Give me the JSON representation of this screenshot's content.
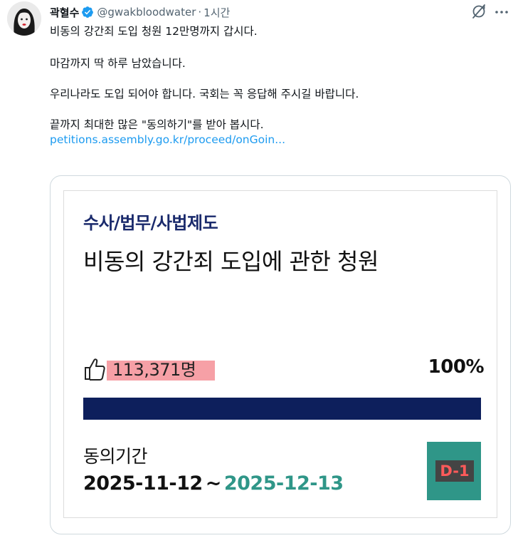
{
  "tweet": {
    "author_name": "곽혈수",
    "author_handle": "@gwakbloodwater",
    "separator": "·",
    "time": "1시간",
    "lines": [
      "비동의 강간죄 도입 청원 12만명까지 갑시다.",
      "마감까지 딱 하루 남았습니다.",
      "우리나라도 도입 되어야 합니다. 국회는 꼭 응답해 주시길 바랍니다.",
      "끝까지 최대한 많은 \"동의하기\"를 받아 봅시다."
    ],
    "link": "petitions.assembly.go.kr/proceed/onGoin..."
  },
  "icons": {
    "avatar": "avatar",
    "verified": "verified-badge-icon",
    "grok": "grok-icon",
    "more": "more-options-icon",
    "thumb": "thumbs-up-icon"
  },
  "card": {
    "category": "수사/법무/사법제도",
    "title": "비동의 강간죄 도입에 관한 청원",
    "count": "113,371명",
    "percent": "100%",
    "progress": 1.0,
    "period_label": "동의기간",
    "start_date": "2025-11-12",
    "date_separator": "~",
    "end_date": "2025-12-13",
    "dday": "D-1"
  },
  "colors": {
    "link": "#1d9bf0",
    "verified": "#1d9bf0",
    "category": "#1a2a6c",
    "progress": "#0d1f5c",
    "highlight": "#f6a0a6",
    "teal": "#2f9688",
    "dday_text": "#ff5a5a"
  }
}
